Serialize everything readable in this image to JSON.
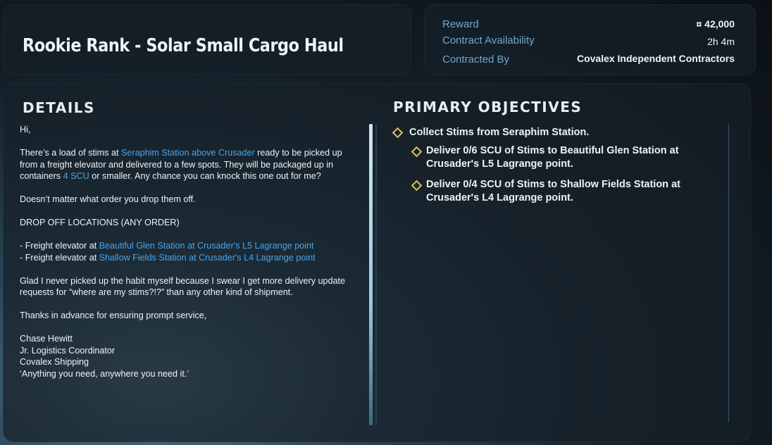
{
  "contract": {
    "title": "Rookie Rank - Solar Small Cargo Haul",
    "reward_label": "Reward",
    "reward_value": "¤ 42,000",
    "availability_label": "Contract Availability",
    "availability_value": "2h 4m",
    "contracted_by_label": "Contracted By",
    "contracted_by_value": "Covalex Independent Contractors"
  },
  "details": {
    "heading": "DETAILS",
    "greeting": "Hi,",
    "p1_a": "There’s a load of stims at ",
    "p1_link": "Seraphim Station above Crusader",
    "p1_b": " ready to be picked up from a freight elevator and delivered to a few spots. They will be packaged up in containers ",
    "p1_link2": "4 SCU",
    "p1_c": " or smaller. Any chance you can knock this one out for me?",
    "p2": "Doesn’t matter what order you drop them off.",
    "p3": "DROP OFF LOCATIONS (ANY ORDER)",
    "loc1_prefix": "- Freight elevator at ",
    "loc1_link": "Beautiful Glen Station at Crusader's L5 Lagrange point",
    "loc2_prefix": "- Freight elevator at ",
    "loc2_link": "Shallow Fields Station at Crusader's L4 Lagrange point",
    "p4": "Glad I never picked up the habit myself because I swear I get more delivery update requests for “where are my stims?!?” than any other kind of shipment.",
    "p5": "Thanks in advance for ensuring prompt service,",
    "sig_name": "Chase Hewitt",
    "sig_title": "Jr. Logistics Coordinator",
    "sig_company": "Covalex Shipping",
    "sig_motto": "‘Anything you need, anywhere you need it.’"
  },
  "objectives": {
    "heading": "PRIMARY OBJECTIVES",
    "main": "Collect Stims from Seraphim Station.",
    "sub1": "Deliver 0/6 SCU of Stims to Beautiful Glen Station at Crusader's L5 Lagrange point.",
    "sub2": "Deliver 0/4 SCU of Stims to Shallow Fields Station at Crusader's L4 Lagrange point."
  },
  "colors": {
    "link": "#4ba3e8",
    "label": "#6fa8cf",
    "diamond": "#e0c060"
  }
}
